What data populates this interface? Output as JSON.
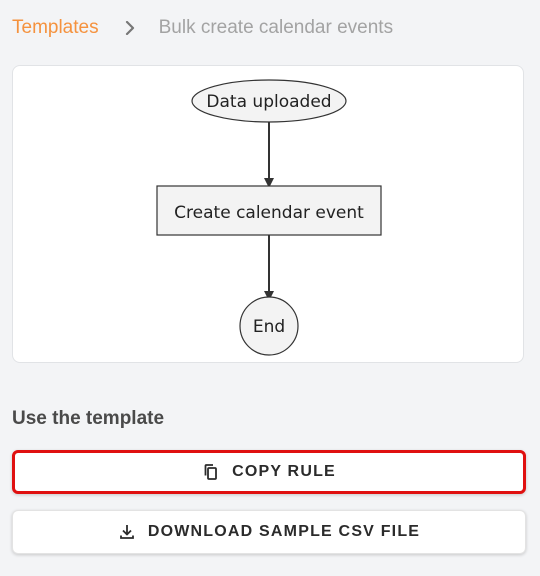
{
  "breadcrumb": {
    "link_label": "Templates",
    "separator_icon": "chevron-right-icon",
    "current_label": "Bulk create calendar events"
  },
  "flowchart": {
    "nodes": [
      {
        "id": "start",
        "shape": "ellipse",
        "label": "Data uploaded"
      },
      {
        "id": "action",
        "shape": "rectangle",
        "label": "Create calendar event"
      },
      {
        "id": "end",
        "shape": "circle",
        "label": "End"
      }
    ],
    "edges": [
      {
        "from": "start",
        "to": "action"
      },
      {
        "from": "action",
        "to": "end"
      }
    ]
  },
  "template_section": {
    "title": "Use the template"
  },
  "buttons": {
    "copy": {
      "label": "COPY RULE",
      "icon": "copy-icon"
    },
    "download": {
      "label": "DOWNLOAD SAMPLE CSV FILE",
      "icon": "download-icon"
    }
  },
  "colors": {
    "accent": "#f5923e",
    "highlight_border": "#e01010",
    "muted_text": "#a3a3a3",
    "background": "#f3f4f6"
  }
}
